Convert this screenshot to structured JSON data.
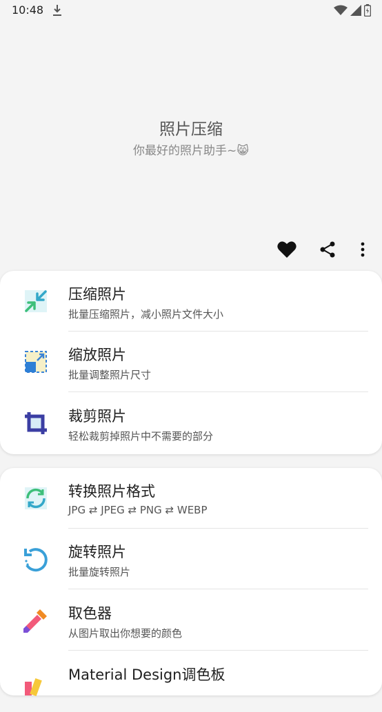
{
  "status": {
    "time": "10:48"
  },
  "hero": {
    "title": "照片压缩",
    "subtitle": "你最好的照片助手~😸"
  },
  "toolbar": {
    "favorite_icon": "heart-icon",
    "share_icon": "share-icon",
    "more_icon": "more-vert-icon"
  },
  "colors": {
    "background": "#f4f4f4",
    "card": "#ffffff",
    "title": "#1f1f1f",
    "subtitle": "#555555"
  },
  "card1": {
    "items": [
      {
        "title": "压缩照片",
        "subtitle": "批量压缩照片，减小照片文件大小",
        "icon": "compress-icon"
      },
      {
        "title": "缩放照片",
        "subtitle": "批量调整照片尺寸",
        "icon": "resize-icon"
      },
      {
        "title": "裁剪照片",
        "subtitle": "轻松裁剪掉照片中不需要的部分",
        "icon": "crop-icon"
      }
    ]
  },
  "card2": {
    "items": [
      {
        "title": "转换照片格式",
        "subtitle": "JPG ⇄ JPEG ⇄ PNG ⇄ WEBP",
        "icon": "convert-icon"
      },
      {
        "title": "旋转照片",
        "subtitle": "批量旋转照片",
        "icon": "rotate-icon"
      },
      {
        "title": "取色器",
        "subtitle": "从图片取出你想要的颜色",
        "icon": "eyedropper-icon"
      },
      {
        "title": "Material Design调色板",
        "subtitle": "",
        "icon": "palette-icon"
      }
    ]
  }
}
